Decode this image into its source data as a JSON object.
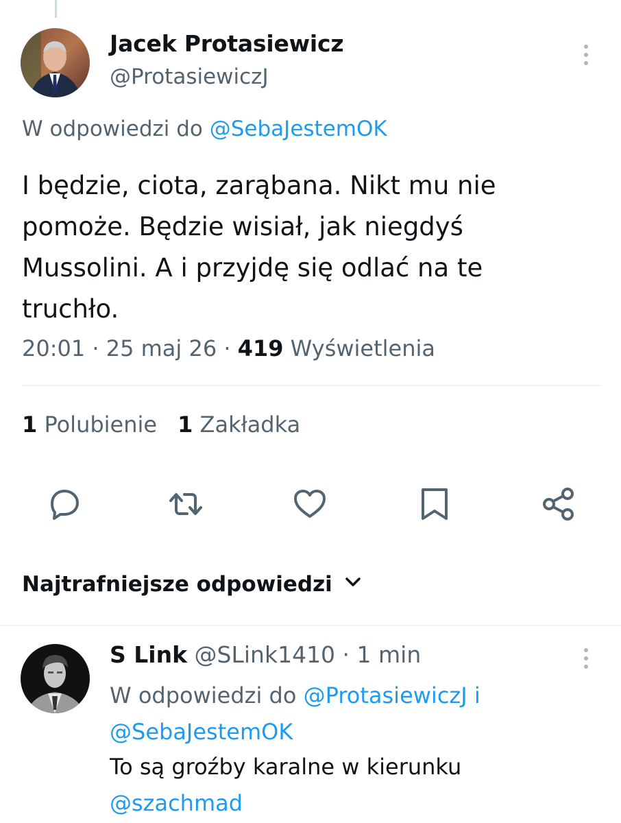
{
  "tweet": {
    "author_name": "Jacek Protasiewicz",
    "author_handle": "@ProtasiewiczJ",
    "reply_to_prefix": "W odpowiedzi do ",
    "reply_to_user": "@SebaJestemOK",
    "text": "I będzie, ciota, zarąbana. Nikt mu nie\npomoże. Będzie wisiał, jak niegdyś\nMussolini. A i przyjdę się odlać  na te\ntruchło.",
    "time": "20:01",
    "date": "25 maj 26",
    "views_count": "419",
    "views_label": "Wyświetlenia",
    "separator": " · ",
    "likes_count": "1",
    "likes_label": "Polubienie",
    "bookmarks_count": "1",
    "bookmarks_label": "Zakładka"
  },
  "actions": {
    "reply_icon": "reply-icon",
    "retweet_icon": "retweet-icon",
    "like_icon": "heart-icon",
    "bookmark_icon": "bookmark-icon",
    "share_icon": "share-icon"
  },
  "replies_section": {
    "title": "Najtrafniejsze odpowiedzi"
  },
  "reply": {
    "author_name": "S Link",
    "author_handle": "@SLink1410",
    "time_ago": "1 min",
    "reply_to_prefix": "W odpowiedzi do ",
    "reply_to_user1": "@ProtasiewiczJ",
    "reply_to_joiner": " i",
    "reply_to_user2": "@SebaJestemOK",
    "text_line1": "To są groźby karalne w kierunku",
    "text_mention": "@szachmad"
  },
  "colors": {
    "accent": "#1d9bf0",
    "secondary_text": "#536471",
    "primary_text": "#0f1419",
    "divider": "#eff3f4"
  }
}
